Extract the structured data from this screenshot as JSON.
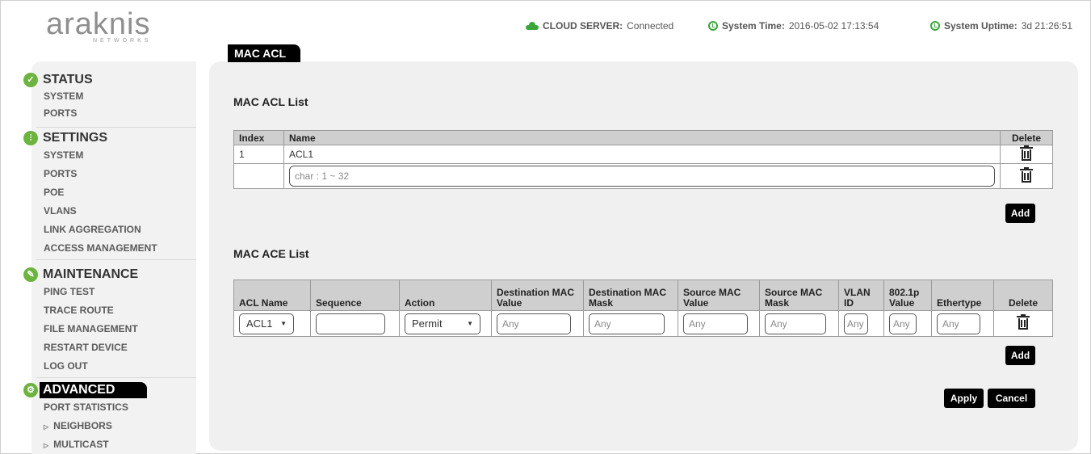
{
  "brand": {
    "logo_text": "araknis",
    "logo_sub": "NETWORKS"
  },
  "status_bar": {
    "cloud_label": "CLOUD SERVER:",
    "cloud_value": "Connected",
    "time_label": "System Time:",
    "time_value": "2016-05-02 17:13:54",
    "uptime_label": "System Uptime:",
    "uptime_value": "3d 21:26:51"
  },
  "sidebar": {
    "status": {
      "title": "STATUS",
      "items": [
        "SYSTEM",
        "PORTS"
      ]
    },
    "settings": {
      "title": "SETTINGS",
      "items": [
        "SYSTEM",
        "PORTS",
        "POE",
        "VLANS",
        "LINK AGGREGATION",
        "ACCESS MANAGEMENT"
      ]
    },
    "maintenance": {
      "title": "MAINTENANCE",
      "items": [
        "PING TEST",
        "TRACE ROUTE",
        "FILE MANAGEMENT",
        "RESTART DEVICE",
        "LOG OUT"
      ]
    },
    "advanced": {
      "title": "ADVANCED",
      "items": [
        "PORT STATISTICS",
        "NEIGHBORS",
        "MULTICAST"
      ]
    }
  },
  "page": {
    "tab_title": "MAC ACL"
  },
  "acl_list": {
    "title": "MAC ACL List",
    "headers": {
      "index": "Index",
      "name": "Name",
      "delete": "Delete"
    },
    "rows": [
      {
        "index": "1",
        "name": "ACL1"
      }
    ],
    "new_name_placeholder": "char : 1 ~ 32",
    "add_label": "Add"
  },
  "ace_list": {
    "title": "MAC ACE List",
    "headers": {
      "acl_name": "ACL Name",
      "sequence": "Sequence",
      "action": "Action",
      "dest_mac_value": "Destination MAC Value",
      "dest_mac_mask": "Destination MAC Mask",
      "src_mac_value": "Source MAC Value",
      "src_mac_mask": "Source MAC Mask",
      "vlan_id": "VLAN ID",
      "dot1p_value": "802.1p Value",
      "ethertype": "Ethertype",
      "delete": "Delete"
    },
    "row": {
      "acl_name": "ACL1",
      "sequence": "",
      "action": "Permit",
      "dest_mac_value": "Any",
      "dest_mac_mask": "Any",
      "src_mac_value": "Any",
      "src_mac_mask": "Any",
      "vlan_id": "Any",
      "dot1p_value": "Any",
      "ethertype": "Any"
    },
    "add_label": "Add"
  },
  "footer": {
    "apply_label": "Apply",
    "cancel_label": "Cancel"
  },
  "colors": {
    "accent_green": "#6db33f",
    "cloud_green": "#3aa63a",
    "black": "#000000",
    "panel_bg": "#f0f0f0"
  }
}
